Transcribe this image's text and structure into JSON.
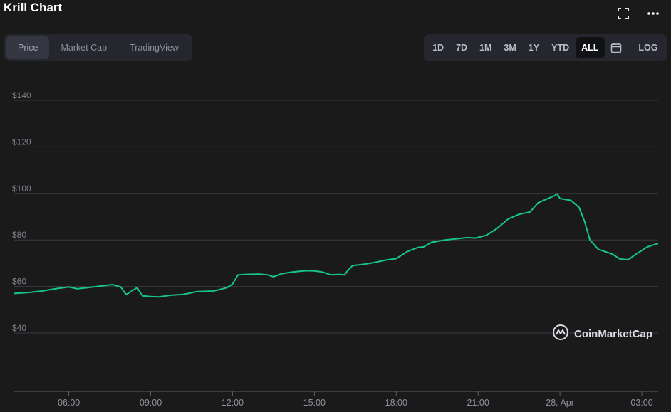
{
  "header": {
    "title": "Krill Chart"
  },
  "tabs": [
    {
      "label": "Price"
    },
    {
      "label": "Market Cap"
    },
    {
      "label": "TradingView"
    }
  ],
  "ranges": [
    {
      "label": "1D"
    },
    {
      "label": "7D"
    },
    {
      "label": "1M"
    },
    {
      "label": "3M"
    },
    {
      "label": "1Y"
    },
    {
      "label": "YTD"
    },
    {
      "label": "ALL"
    }
  ],
  "log_label": "LOG",
  "icons": {
    "fullscreen": "fullscreen-icon",
    "more": "more-icon",
    "calendar": "calendar-icon",
    "logo": "coinmarketcap-logo-icon"
  },
  "watermark": "CoinMarketCap",
  "colors": {
    "line": "#16c784",
    "background": "#1a1a1b",
    "grid": "#3a3b40",
    "active_range": "#111216"
  },
  "chart_data": {
    "type": "line",
    "title": "Krill Chart",
    "xlabel": "",
    "ylabel": "",
    "ylim": [
      20,
      145
    ],
    "y_ticks": [
      40,
      60,
      80,
      100,
      120,
      140
    ],
    "y_tick_labels": [
      "$40",
      "$60",
      "$80",
      "$100",
      "$120",
      "$140"
    ],
    "x_tick_labels": [
      "06:00",
      "09:00",
      "12:00",
      "15:00",
      "18:00",
      "21:00",
      "28. Apr",
      "03:00"
    ],
    "x_tick_hours": [
      6,
      9,
      12,
      15,
      18,
      21,
      24,
      27
    ],
    "xlim_hours": [
      4,
      27.6
    ],
    "grid": true,
    "series": [
      {
        "values": [
          [
            4.0,
            57.0
          ],
          [
            4.5,
            57.4
          ],
          [
            5.0,
            58.0
          ],
          [
            5.5,
            59.0
          ],
          [
            6.0,
            59.8
          ],
          [
            6.3,
            59.0
          ],
          [
            6.7,
            59.5
          ],
          [
            7.2,
            60.2
          ],
          [
            7.6,
            60.8
          ],
          [
            7.9,
            59.8
          ],
          [
            8.1,
            56.5
          ],
          [
            8.5,
            59.5
          ],
          [
            8.7,
            56.0
          ],
          [
            9.0,
            55.7
          ],
          [
            9.3,
            55.5
          ],
          [
            9.7,
            56.2
          ],
          [
            10.2,
            56.6
          ],
          [
            10.7,
            57.8
          ],
          [
            11.3,
            58.0
          ],
          [
            11.8,
            59.5
          ],
          [
            12.0,
            61.0
          ],
          [
            12.2,
            65.0
          ],
          [
            12.5,
            65.2
          ],
          [
            13.0,
            65.3
          ],
          [
            13.3,
            65.0
          ],
          [
            13.5,
            64.2
          ],
          [
            13.8,
            65.5
          ],
          [
            14.2,
            66.2
          ],
          [
            14.7,
            66.8
          ],
          [
            15.0,
            66.7
          ],
          [
            15.3,
            66.2
          ],
          [
            15.6,
            65.0
          ],
          [
            15.9,
            65.2
          ],
          [
            16.1,
            65.0
          ],
          [
            16.2,
            66.5
          ],
          [
            16.4,
            69.0
          ],
          [
            16.8,
            69.5
          ],
          [
            17.2,
            70.3
          ],
          [
            17.6,
            71.3
          ],
          [
            18.0,
            72.0
          ],
          [
            18.4,
            75.0
          ],
          [
            18.8,
            76.8
          ],
          [
            19.0,
            77.0
          ],
          [
            19.3,
            79.0
          ],
          [
            19.8,
            80.0
          ],
          [
            20.2,
            80.5
          ],
          [
            20.6,
            81.0
          ],
          [
            20.9,
            80.8
          ],
          [
            21.3,
            82.0
          ],
          [
            21.7,
            85.0
          ],
          [
            22.1,
            89.0
          ],
          [
            22.5,
            91.0
          ],
          [
            22.9,
            92.0
          ],
          [
            23.2,
            96.0
          ],
          [
            23.6,
            98.0
          ],
          [
            23.8,
            99.0
          ],
          [
            23.9,
            99.8
          ],
          [
            24.0,
            97.8
          ],
          [
            24.4,
            97.0
          ],
          [
            24.7,
            94.0
          ],
          [
            24.9,
            88.0
          ],
          [
            25.1,
            80.0
          ],
          [
            25.4,
            76.0
          ],
          [
            25.9,
            74.0
          ],
          [
            26.2,
            71.8
          ],
          [
            26.5,
            71.5
          ],
          [
            26.8,
            74.0
          ],
          [
            27.2,
            77.0
          ],
          [
            27.6,
            78.5
          ]
        ]
      }
    ]
  }
}
